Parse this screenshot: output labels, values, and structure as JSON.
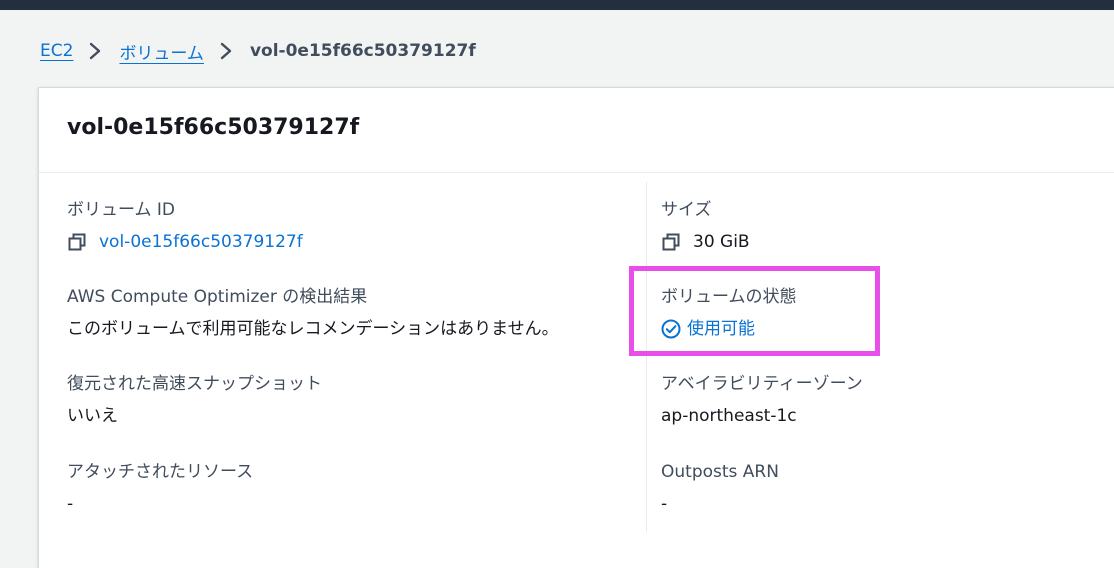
{
  "breadcrumb": {
    "items": [
      {
        "label": "EC2"
      },
      {
        "label": "ボリューム"
      }
    ],
    "current": "vol-0e15f66c50379127f"
  },
  "panel": {
    "title": "vol-0e15f66c50379127f"
  },
  "left_fields": {
    "volume_id": {
      "label": "ボリューム ID",
      "value": "vol-0e15f66c50379127f",
      "icon": "copy-icon"
    },
    "optimizer": {
      "label": "AWS Compute Optimizer の検出結果",
      "value": "このボリュームで利用可能なレコメンデーションはありません。"
    },
    "fast_snapshot": {
      "label": "復元された高速スナップショット",
      "value": "いいえ"
    },
    "attached": {
      "label": "アタッチされたリソース",
      "value": "-"
    }
  },
  "right_fields": {
    "size": {
      "label": "サイズ",
      "value": "30 GiB",
      "icon": "copy-icon"
    },
    "state": {
      "label": "ボリュームの状態",
      "value": "使用可能",
      "icon": "check-circle-icon"
    },
    "az": {
      "label": "アベイラビリティーゾーン",
      "value": "ap-northeast-1c"
    },
    "outposts": {
      "label": "Outposts ARN",
      "value": "-"
    }
  },
  "colors": {
    "link": "#0972d3",
    "highlight": "#e84ee8",
    "topbar": "#232f3e"
  }
}
